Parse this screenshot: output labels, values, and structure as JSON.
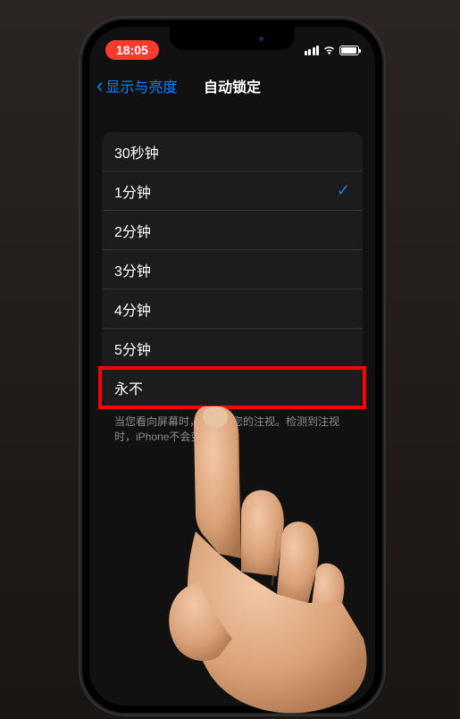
{
  "status": {
    "time": "18:05"
  },
  "nav": {
    "back_label": "显示与亮度",
    "title": "自动锁定"
  },
  "options": [
    {
      "label": "30秒钟",
      "selected": false,
      "highlighted": false
    },
    {
      "label": "1分钟",
      "selected": true,
      "highlighted": false
    },
    {
      "label": "2分钟",
      "selected": false,
      "highlighted": false
    },
    {
      "label": "3分钟",
      "selected": false,
      "highlighted": false
    },
    {
      "label": "4分钟",
      "selected": false,
      "highlighted": false
    },
    {
      "label": "5分钟",
      "selected": false,
      "highlighted": false
    },
    {
      "label": "永不",
      "selected": false,
      "highlighted": true
    }
  ],
  "footer": "当您看向屏幕时，会检测您的注视。检测到注视时，iPhone不会变暗。"
}
